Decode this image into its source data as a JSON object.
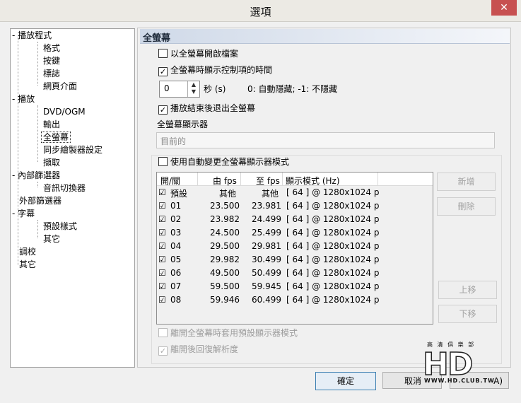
{
  "window": {
    "title": "選項",
    "close_glyph": "✕"
  },
  "tree": {
    "items": [
      {
        "label": "播放程式"
      },
      {
        "label": "格式"
      },
      {
        "label": "按鍵"
      },
      {
        "label": "標誌"
      },
      {
        "label": "網頁介面"
      },
      {
        "label": "播放"
      },
      {
        "label": "DVD/OGM"
      },
      {
        "label": "輸出"
      },
      {
        "label": "全螢幕"
      },
      {
        "label": "同步繪製器設定"
      },
      {
        "label": "擷取"
      },
      {
        "label": "內部篩選器"
      },
      {
        "label": "音訊切換器"
      },
      {
        "label": "外部篩選器"
      },
      {
        "label": "字幕"
      },
      {
        "label": "預設樣式"
      },
      {
        "label": "其它"
      },
      {
        "label": "調校"
      },
      {
        "label": "其它"
      }
    ],
    "expander": "-"
  },
  "panel": {
    "title": "全螢幕",
    "launch_fullscreen": {
      "label": "以全螢幕開啟檔案",
      "checked": false
    },
    "show_controls_time": {
      "label": "全螢幕時顯示控制項的時間",
      "checked": true
    },
    "spin": {
      "value": "0",
      "unit": "秒 (s)",
      "hint": "0: 自動隱藏; -1: 不隱藏",
      "up": "▲",
      "down": "▼"
    },
    "exit_after_playback": {
      "label": "播放結束後退出全螢幕",
      "checked": true
    },
    "monitor_label": "全螢幕顯示器",
    "monitor_combo": {
      "value": "目前的",
      "arrow": "⌵"
    },
    "auto_change_mode": {
      "label": "使用自動變更全螢幕顯示器模式",
      "checked": false
    },
    "table": {
      "headers": [
        "開/關",
        "由 fps",
        "至 fps",
        "顯示模式 (Hz)"
      ],
      "rows": [
        {
          "on": "☑",
          "name": "預設",
          "from": "其他",
          "to": "其他",
          "mode": "[ 64 ] @ 1280x1024 p"
        },
        {
          "on": "☑",
          "name": "01",
          "from": "23.500",
          "to": "23.981",
          "mode": "[ 64 ] @ 1280x1024 p"
        },
        {
          "on": "☑",
          "name": "02",
          "from": "23.982",
          "to": "24.499",
          "mode": "[ 64 ] @ 1280x1024 p"
        },
        {
          "on": "☑",
          "name": "03",
          "from": "24.500",
          "to": "25.499",
          "mode": "[ 64 ] @ 1280x1024 p"
        },
        {
          "on": "☑",
          "name": "04",
          "from": "29.500",
          "to": "29.981",
          "mode": "[ 64 ] @ 1280x1024 p"
        },
        {
          "on": "☑",
          "name": "05",
          "from": "29.982",
          "to": "30.499",
          "mode": "[ 64 ] @ 1280x1024 p"
        },
        {
          "on": "☑",
          "name": "06",
          "from": "49.500",
          "to": "50.499",
          "mode": "[ 64 ] @ 1280x1024 p"
        },
        {
          "on": "☑",
          "name": "07",
          "from": "59.500",
          "to": "59.945",
          "mode": "[ 64 ] @ 1280x1024 p"
        },
        {
          "on": "☑",
          "name": "08",
          "from": "59.946",
          "to": "60.499",
          "mode": "[ 64 ] @ 1280x1024 p"
        }
      ]
    },
    "buttons": {
      "add": "新增",
      "delete": "刪除",
      "up": "上移",
      "down": "下移"
    },
    "restore_default_on_exit": {
      "label": "離開全螢幕時套用預設顯示器模式",
      "checked": false
    },
    "restore_resolution": {
      "label": "離開後回復解析度",
      "checked": true
    },
    "check_glyph": "✓"
  },
  "footer": {
    "ok": "確定",
    "cancel": "取消",
    "apply_suffix": "A)"
  },
  "watermark": {
    "big": "HD",
    "small": "WWW.HD.CLUB.TW",
    "top": "高 清 俱 樂 部"
  }
}
